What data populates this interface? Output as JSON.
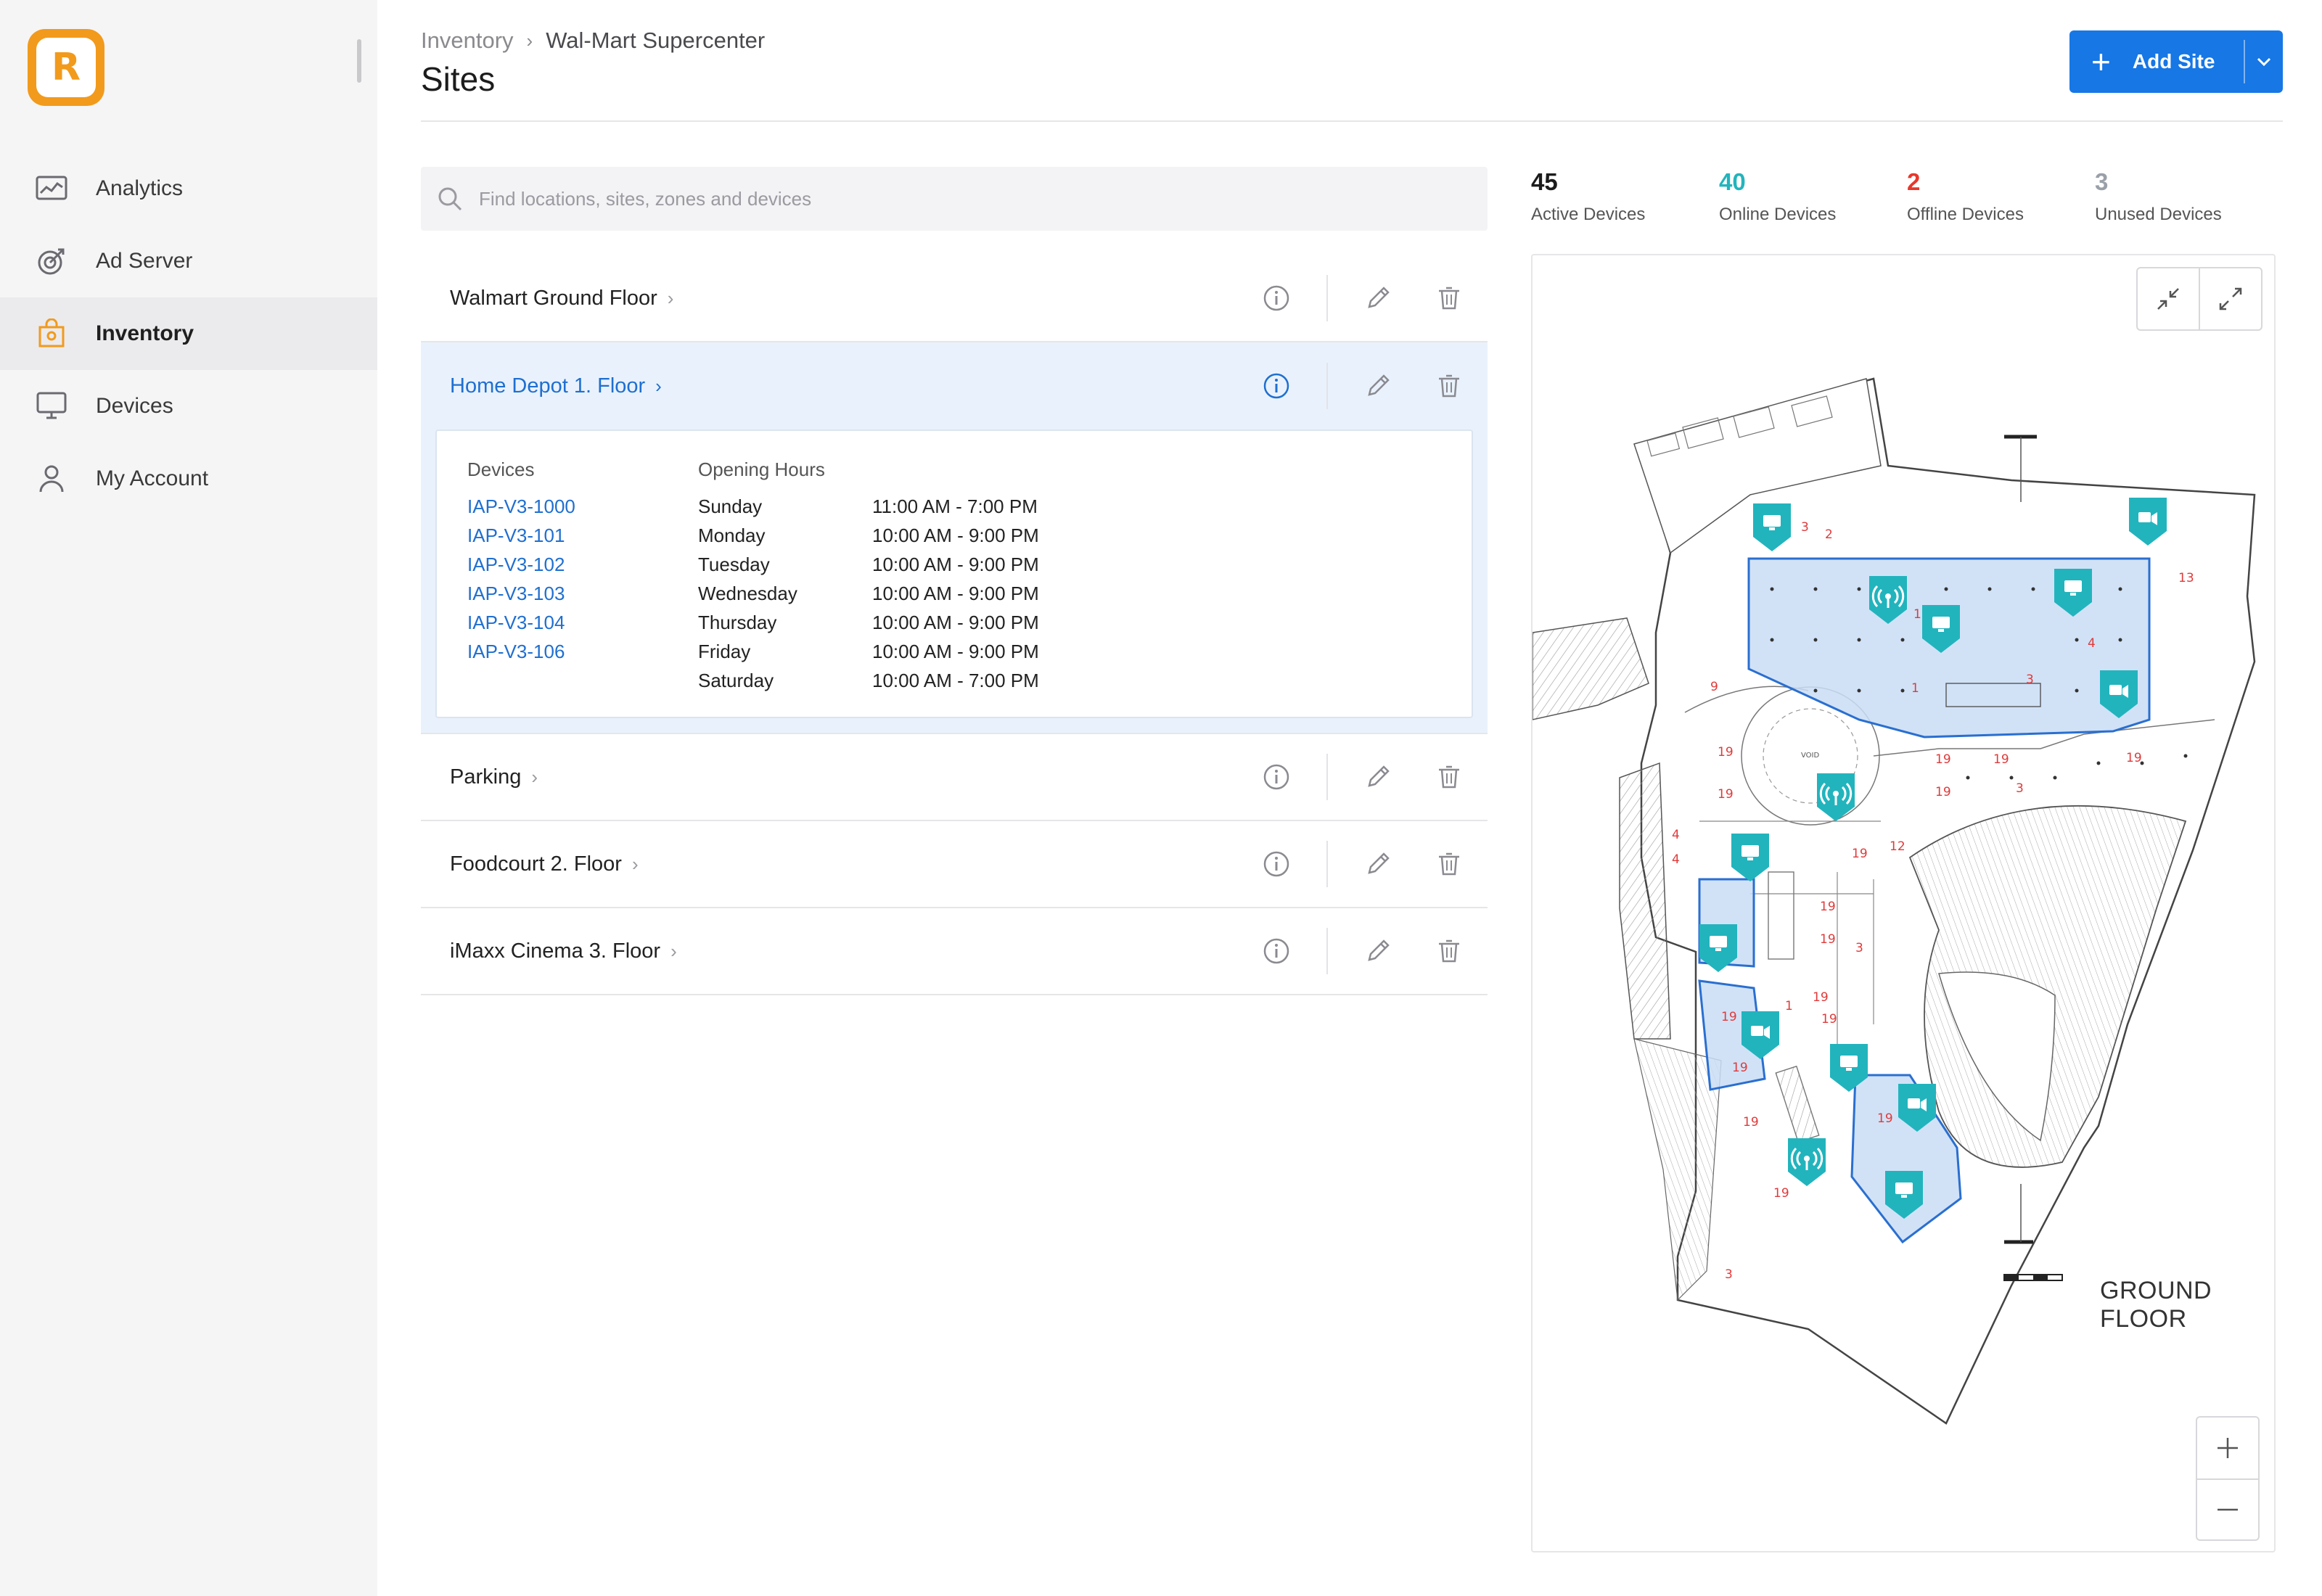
{
  "app": {
    "logo_letter": "R",
    "brand_color": "#f29a1c"
  },
  "sidebar": {
    "items": [
      {
        "label": "Analytics",
        "icon": "analytics-icon"
      },
      {
        "label": "Ad Server",
        "icon": "ad-server-icon"
      },
      {
        "label": "Inventory",
        "icon": "inventory-icon",
        "active": true
      },
      {
        "label": "Devices",
        "icon": "devices-icon"
      },
      {
        "label": "My Account",
        "icon": "account-icon"
      }
    ]
  },
  "header": {
    "breadcrumb": [
      "Inventory",
      "Wal-Mart Supercenter"
    ],
    "title": "Sites",
    "add_button": "Add Site",
    "accent": "#1677e5"
  },
  "search": {
    "placeholder": "Find locations, sites, zones and devices"
  },
  "sites": [
    {
      "name": "Walmart Ground Floor"
    },
    {
      "name": "Home Depot 1. Floor",
      "expanded": true
    },
    {
      "name": "Parking"
    },
    {
      "name": "Foodcourt 2. Floor"
    },
    {
      "name": "iMaxx Cinema 3. Floor"
    }
  ],
  "details": {
    "devices_header": "Devices",
    "hours_header": "Opening Hours",
    "devices": [
      "IAP-V3-1000",
      "IAP-V3-101",
      "IAP-V3-102",
      "IAP-V3-103",
      "IAP-V3-104",
      "IAP-V3-106"
    ],
    "hours": [
      {
        "day": "Sunday",
        "time": "11:00 AM - 7:00 PM"
      },
      {
        "day": "Monday",
        "time": "10:00 AM - 9:00 PM"
      },
      {
        "day": "Tuesday",
        "time": "10:00 AM - 9:00 PM"
      },
      {
        "day": "Wednesday",
        "time": "10:00 AM - 9:00 PM"
      },
      {
        "day": "Thursday",
        "time": "10:00 AM - 9:00 PM"
      },
      {
        "day": "Friday",
        "time": "10:00 AM - 9:00 PM"
      },
      {
        "day": "Saturday",
        "time": "10:00 AM - 7:00 PM"
      }
    ]
  },
  "stats": [
    {
      "value": "45",
      "label": "Active Devices",
      "color": "#1c1c1c"
    },
    {
      "value": "40",
      "label": "Online Devices",
      "color": "#22b4bd"
    },
    {
      "value": "2",
      "label": "Offline Devices",
      "color": "#e8372c"
    },
    {
      "value": "3",
      "label": "Unused Devices",
      "color": "#9aa0a8"
    }
  ],
  "map": {
    "floor_label": "GROUND FLOOR",
    "marker_color": "#22b4bd",
    "zone_fill": "#c9ddf6",
    "zone_stroke": "#2a6fd0",
    "room_number_color": "#e03a3a",
    "void_label": "VOID",
    "room_numbers": [
      "3",
      "2",
      "1",
      "13",
      "9",
      "19",
      "19",
      "19",
      "19",
      "19",
      "19",
      "12",
      "19",
      "19",
      "3",
      "4",
      "4",
      "19",
      "19",
      "19",
      "19",
      "19",
      "19",
      "19",
      "19",
      "3",
      "1",
      "4",
      "3",
      "3",
      "1"
    ]
  }
}
